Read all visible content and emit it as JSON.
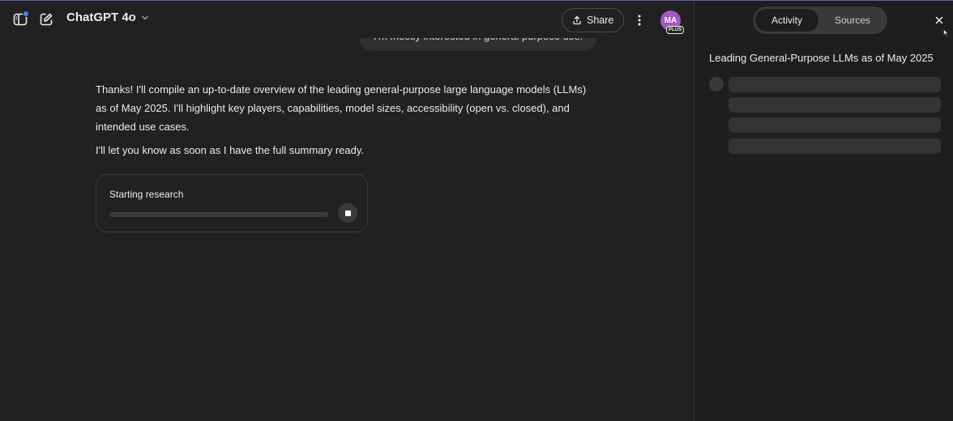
{
  "header": {
    "model_name": "ChatGPT 4o",
    "share_label": "Share",
    "avatar_initials": "MA",
    "plan_badge": "PLUS"
  },
  "icons": {
    "sidebar_toggle": "sidebar-toggle-icon",
    "new_chat": "new-chat-icon",
    "model_chevron": "chevron-down-icon",
    "share": "share-icon",
    "more": "more-vertical-icon",
    "stop": "stop-icon",
    "close": "close-icon"
  },
  "conversation": {
    "user_message": "I'm mostly interested in general purpose use.",
    "assistant_paragraphs": [
      "Thanks! I'll compile an up-to-date overview of the leading general-purpose large language models (LLMs) as of May 2025. I'll highlight key players, capabilities, model sizes, accessibility (open vs. closed), and intended use cases.",
      "I'll let you know as soon as I have the full summary ready."
    ],
    "research": {
      "status": "Starting research",
      "progress": 0
    }
  },
  "panel": {
    "tabs": [
      {
        "label": "Activity",
        "active": true
      },
      {
        "label": "Sources",
        "active": false
      }
    ],
    "title": "Leading General-Purpose LLMs as of May 2025"
  },
  "colors": {
    "background": "#212121",
    "panel_background": "#1e1e1e",
    "avatar": "#a457c5",
    "notification_dot": "#3b82f6"
  }
}
